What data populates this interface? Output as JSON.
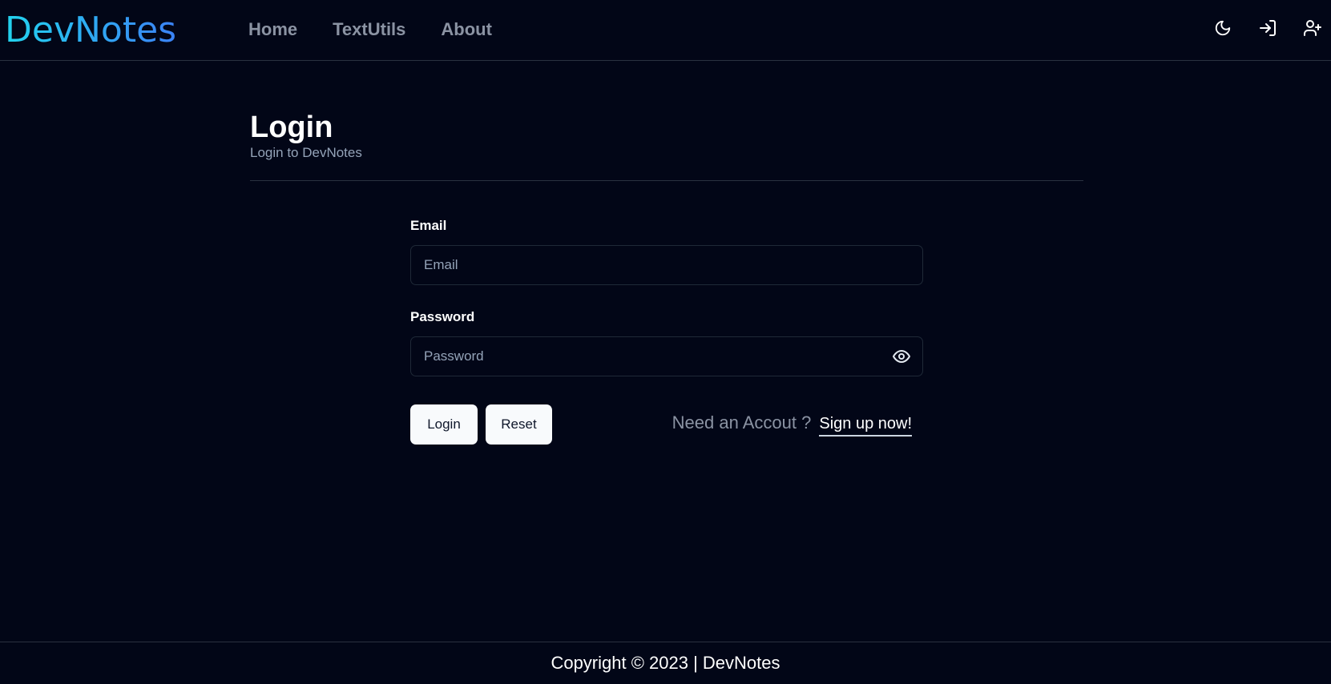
{
  "brand": "DevNotes",
  "nav": {
    "links": [
      "Home",
      "TextUtils",
      "About"
    ],
    "icons": [
      "moon-icon",
      "login-icon",
      "user-plus-icon"
    ]
  },
  "header": {
    "title": "Login",
    "subtitle": "Login to DevNotes"
  },
  "form": {
    "email_label": "Email",
    "email_placeholder": "Email",
    "email_value": "",
    "password_label": "Password",
    "password_placeholder": "Password",
    "password_value": "",
    "login_button": "Login",
    "reset_button": "Reset",
    "signup_prompt": "Need an Accout ?",
    "signup_link": "Sign up now!"
  },
  "footer": {
    "text": "Copyright © 2023 | DevNotes"
  },
  "colors": {
    "background": "#020617",
    "brand_gradient_start": "#22d3ee",
    "brand_gradient_end": "#3b82f6",
    "button_bg": "#f8fafc",
    "muted_text": "#94a3b8"
  }
}
